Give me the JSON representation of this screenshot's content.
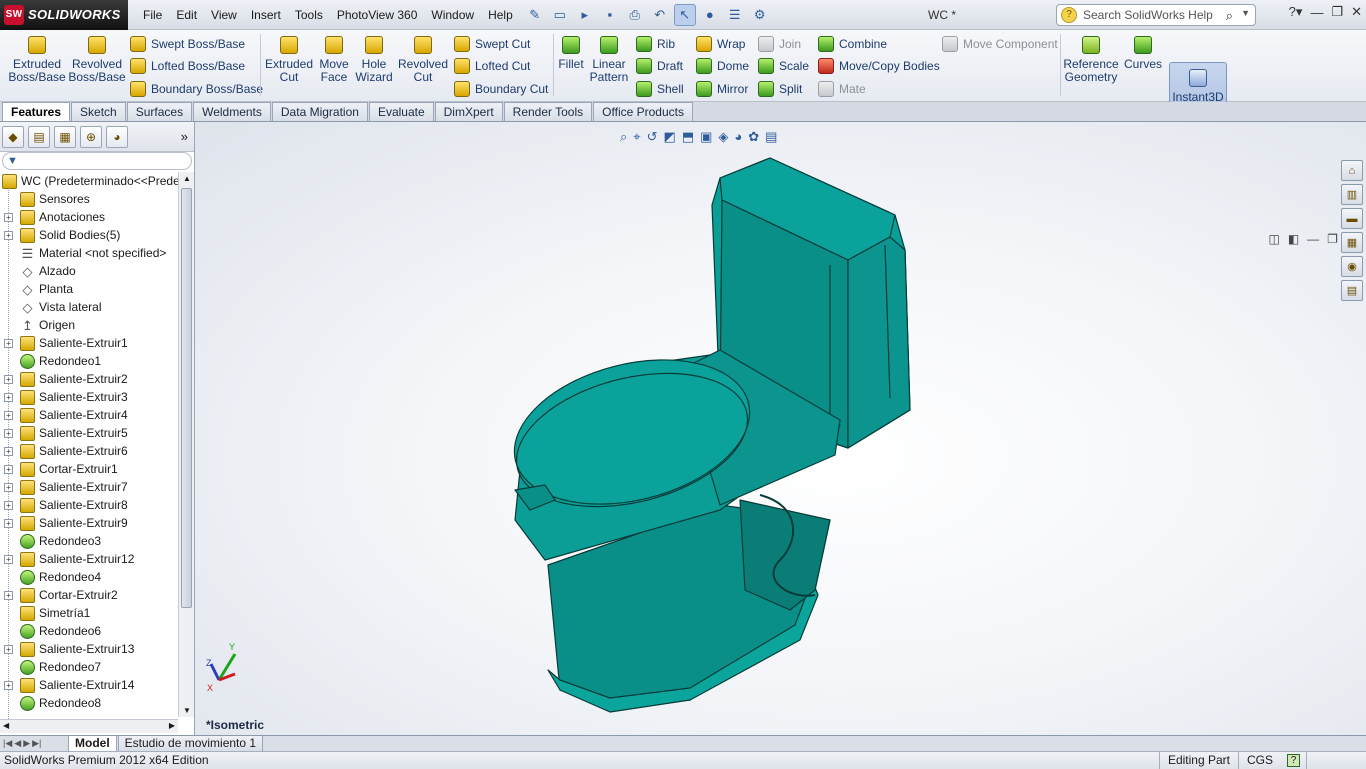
{
  "app": {
    "brand": "SOLIDWORKS",
    "document_title": "WC *"
  },
  "menu": [
    "File",
    "Edit",
    "View",
    "Insert",
    "Tools",
    "PhotoView 360",
    "Window",
    "Help"
  ],
  "search": {
    "placeholder": "Search SolidWorks Help"
  },
  "ribbon": {
    "extruded_boss": "Extruded Boss/Base",
    "revolved_boss": "Revolved Boss/Base",
    "swept_boss": "Swept Boss/Base",
    "lofted_boss": "Lofted Boss/Base",
    "boundary_boss": "Boundary Boss/Base",
    "extruded_cut": "Extruded Cut",
    "move_face": "Move Face",
    "hole_wizard": "Hole Wizard",
    "revolved_cut": "Revolved Cut",
    "swept_cut": "Swept Cut",
    "lofted_cut": "Lofted Cut",
    "boundary_cut": "Boundary Cut",
    "fillet": "Fillet",
    "linear_pattern": "Linear Pattern",
    "rib": "Rib",
    "draft": "Draft",
    "shell": "Shell",
    "wrap": "Wrap",
    "dome": "Dome",
    "mirror": "Mirror",
    "join": "Join",
    "scale": "Scale",
    "split": "Split",
    "combine": "Combine",
    "move_copy": "Move/Copy Bodies",
    "mate": "Mate",
    "move_component": "Move Component",
    "reference_geometry": "Reference Geometry",
    "curves": "Curves",
    "instant3d": "Instant3D"
  },
  "tabs": [
    "Features",
    "Sketch",
    "Surfaces",
    "Weldments",
    "Data Migration",
    "Evaluate",
    "DimXpert",
    "Render Tools",
    "Office Products"
  ],
  "tree": {
    "root": "WC  (Predeterminado<<Predete",
    "items": [
      {
        "label": "Sensores",
        "icon": "sensor-icon",
        "exp": false
      },
      {
        "label": "Anotaciones",
        "icon": "annotation-icon",
        "exp": true
      },
      {
        "label": "Solid Bodies(5)",
        "icon": "solid-bodies-icon",
        "exp": true
      },
      {
        "label": "Material <not specified>",
        "icon": "material-icon",
        "exp": false
      },
      {
        "label": "Alzado",
        "icon": "plane-icon",
        "exp": false
      },
      {
        "label": "Planta",
        "icon": "plane-icon",
        "exp": false
      },
      {
        "label": "Vista lateral",
        "icon": "plane-icon",
        "exp": false
      },
      {
        "label": "Origen",
        "icon": "origin-icon",
        "exp": false
      },
      {
        "label": "Saliente-Extruir1",
        "icon": "extrude-icon",
        "exp": true
      },
      {
        "label": "Redondeo1",
        "icon": "fillet-icon",
        "exp": false
      },
      {
        "label": "Saliente-Extruir2",
        "icon": "extrude-icon",
        "exp": true
      },
      {
        "label": "Saliente-Extruir3",
        "icon": "extrude-icon",
        "exp": true
      },
      {
        "label": "Saliente-Extruir4",
        "icon": "extrude-icon",
        "exp": true
      },
      {
        "label": "Saliente-Extruir5",
        "icon": "extrude-icon",
        "exp": true
      },
      {
        "label": "Saliente-Extruir6",
        "icon": "extrude-icon",
        "exp": true
      },
      {
        "label": "Cortar-Extruir1",
        "icon": "cut-icon",
        "exp": true
      },
      {
        "label": "Saliente-Extruir7",
        "icon": "extrude-icon",
        "exp": true
      },
      {
        "label": "Saliente-Extruir8",
        "icon": "extrude-icon",
        "exp": true
      },
      {
        "label": "Saliente-Extruir9",
        "icon": "extrude-icon",
        "exp": true
      },
      {
        "label": "Redondeo3",
        "icon": "fillet-icon",
        "exp": false
      },
      {
        "label": "Saliente-Extruir12",
        "icon": "extrude-icon",
        "exp": true
      },
      {
        "label": "Redondeo4",
        "icon": "fillet-icon",
        "exp": false
      },
      {
        "label": "Cortar-Extruir2",
        "icon": "cut-icon",
        "exp": true
      },
      {
        "label": "Simetría1",
        "icon": "mirror-icon",
        "exp": false
      },
      {
        "label": "Redondeo6",
        "icon": "fillet-icon",
        "exp": false
      },
      {
        "label": "Saliente-Extruir13",
        "icon": "extrude-icon",
        "exp": true
      },
      {
        "label": "Redondeo7",
        "icon": "fillet-icon",
        "exp": false
      },
      {
        "label": "Saliente-Extruir14",
        "icon": "extrude-icon",
        "exp": true
      },
      {
        "label": "Redondeo8",
        "icon": "fillet-icon",
        "exp": false
      }
    ]
  },
  "viewport": {
    "view_name": "*Isometric",
    "model_color": "#0a9e96"
  },
  "bottom_tabs": [
    "Model",
    "Estudio de movimiento 1"
  ],
  "status": {
    "edition": "SolidWorks Premium 2012 x64 Edition",
    "mode": "Editing Part",
    "units": "CGS",
    "help": "?"
  }
}
